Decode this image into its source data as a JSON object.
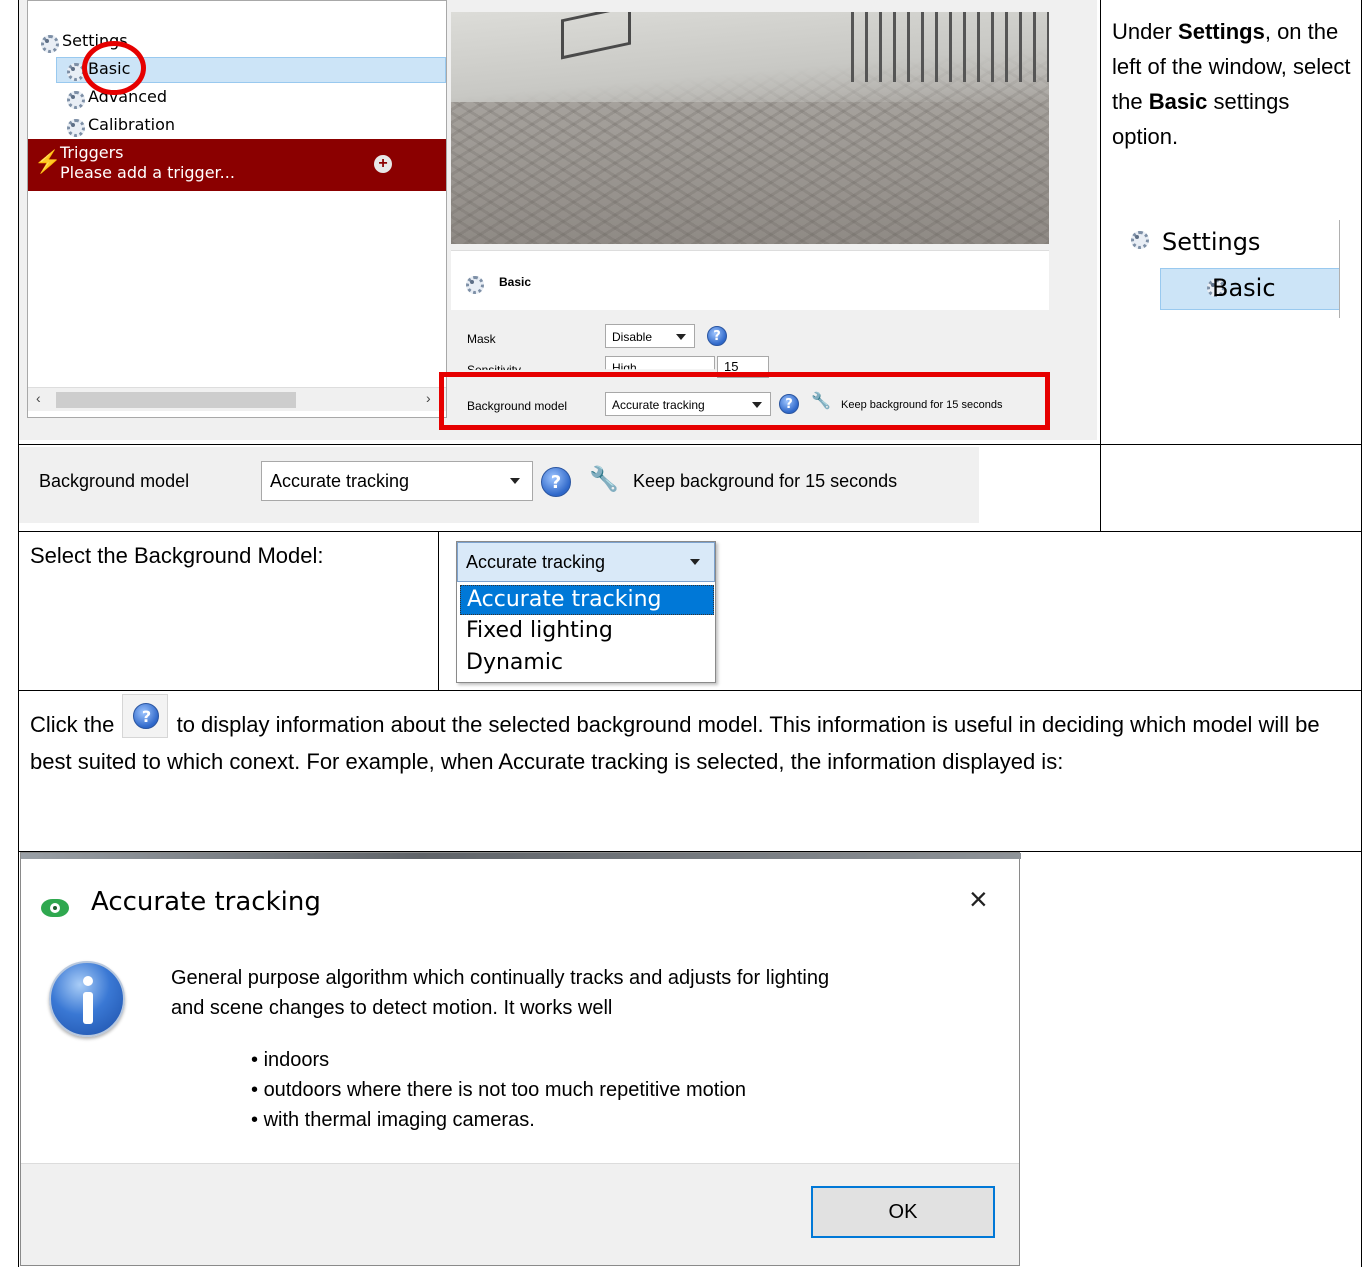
{
  "tree": {
    "settings": "Settings",
    "basic": "Basic",
    "advanced": "Advanced",
    "calibration": "Calibration",
    "triggers": "Triggers",
    "add_trigger": "Please add a trigger..."
  },
  "panel": {
    "title": "Basic",
    "mask_label": "Mask",
    "mask_value": "Disable",
    "sensitivity_label": "Sensitivity",
    "sensitivity_value": "High",
    "sensitivity_number": "15",
    "bg_label": "Background model",
    "bg_value": "Accurate tracking",
    "keep_bg": "Keep background for 15 seconds"
  },
  "instruction": {
    "part1": "Under ",
    "settings_bold": "Settings",
    "part2": ", on the left of the window, select the ",
    "basic_bold": "Basic",
    "part3": " settings option."
  },
  "crop": {
    "settings": "Settings",
    "basic": "Basic"
  },
  "bg_strip": {
    "label": "Background model",
    "value": "Accurate tracking",
    "keep": "Keep background for 15 seconds"
  },
  "select_row": {
    "label": "Select the Background Model:",
    "selected": "Accurate tracking",
    "options": [
      "Accurate tracking",
      "Fixed lighting",
      "Dynamic"
    ]
  },
  "paragraph": {
    "before": "Click the ",
    "after": " to display information about the selected background model. This information is useful in deciding which model will be best suited to which conext.  For example, when Accurate tracking is selected, the information displayed is:"
  },
  "dialog": {
    "title": "Accurate tracking",
    "close": "×",
    "line1": "General purpose algorithm which continually tracks and adjusts for lighting",
    "line2": "and scene changes to detect motion. It works well",
    "bullets": [
      "indoors",
      "outdoors where there is not too much repetitive motion",
      "with thermal imaging cameras."
    ],
    "ok": "OK"
  },
  "colors": {
    "trigger_bg": "#8b0000",
    "selection_bg": "#cce4f7",
    "highlight_red": "#e60000",
    "dropdown_selected": "#0078d7",
    "ok_border": "#0078d7"
  }
}
